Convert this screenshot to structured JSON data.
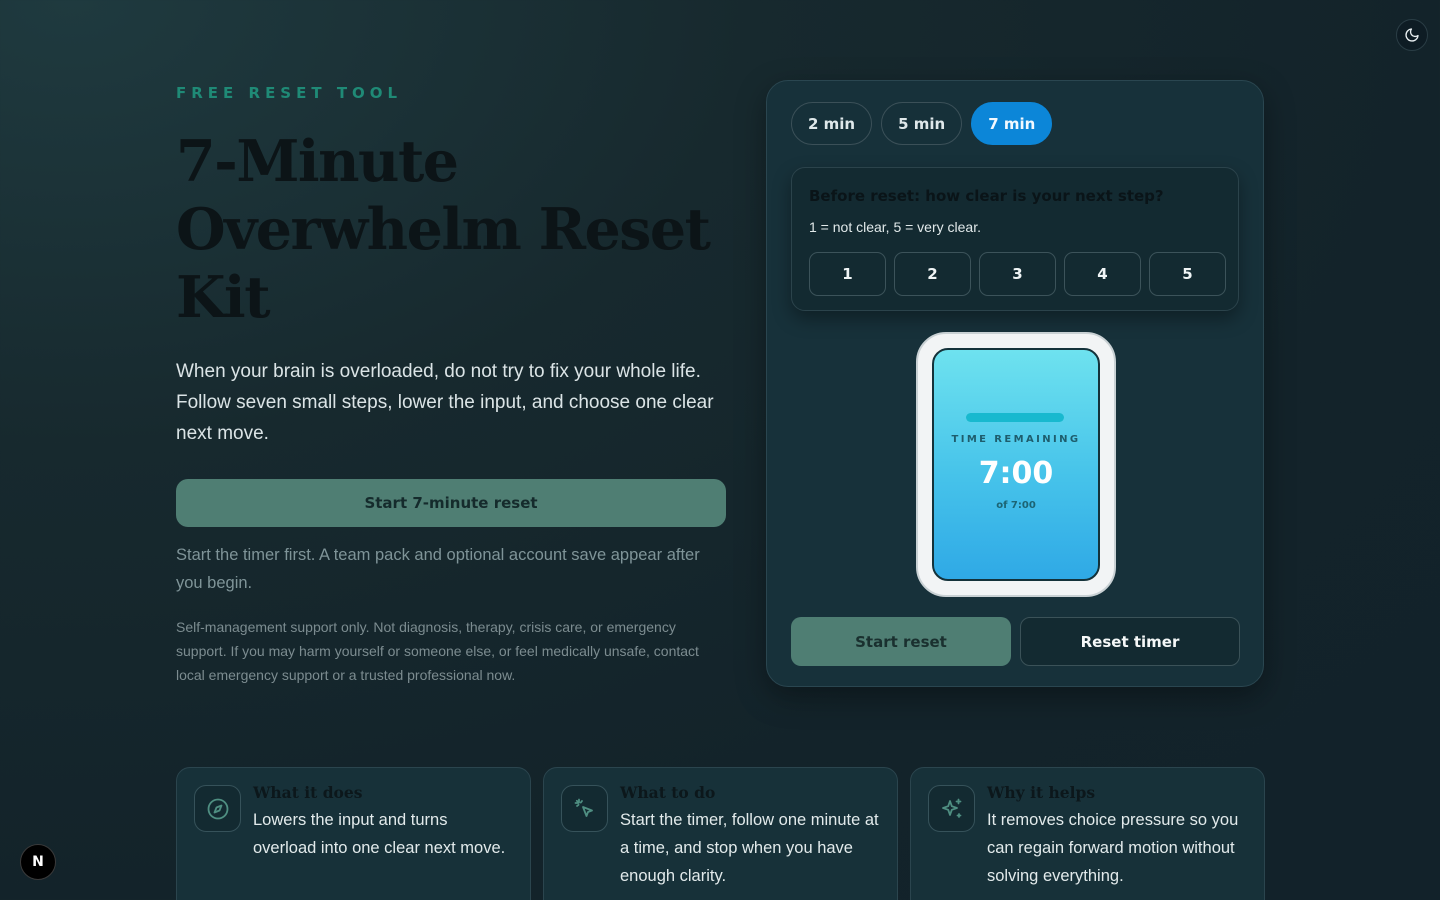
{
  "hero": {
    "eyebrow": "FREE RESET TOOL",
    "title": "7-Minute Overwhelm Reset Kit",
    "description": "When your brain is overloaded, do not try to fix your whole life. Follow seven small steps, lower the input, and choose one clear next move.",
    "cta_label": "Start 7-minute reset",
    "cta_note": "Start the timer first. A team pack and optional account save appear after you begin.",
    "disclaimer": "Self-management support only. Not diagnosis, therapy, crisis care, or emergency support. If you may harm yourself or someone else, or feel medically unsafe, contact local emergency support or a trusted professional now."
  },
  "panel": {
    "durations": [
      {
        "label": "2 min",
        "active": false
      },
      {
        "label": "5 min",
        "active": false
      },
      {
        "label": "7 min",
        "active": true
      }
    ],
    "rating": {
      "question": "Before reset: how clear is your next step?",
      "hint": "1 = not clear, 5 = very clear.",
      "options": [
        "1",
        "2",
        "3",
        "4",
        "5"
      ]
    },
    "timer": {
      "label": "TIME REMAINING",
      "value": "7:00",
      "total": "of 7:00",
      "progress": 1.0
    },
    "start_label": "Start reset",
    "reset_label": "Reset timer"
  },
  "cards": [
    {
      "icon": "compass-icon",
      "title": "What it does",
      "text": "Lowers the input and turns overload into one clear next move."
    },
    {
      "icon": "pointer-click-icon",
      "title": "What to do",
      "text": "Start the timer, follow one minute at a time, and stop when you have enough clarity."
    },
    {
      "icon": "sparkles-icon",
      "title": "Why it helps",
      "text": "It removes choice pressure so you can regain forward motion without solving everything."
    }
  ],
  "badge": {
    "label": "N"
  },
  "colors": {
    "background": "#13232a",
    "accent": "#0c86d8",
    "primary_button": "#4f7e73",
    "eyebrow": "#1f8a76"
  }
}
